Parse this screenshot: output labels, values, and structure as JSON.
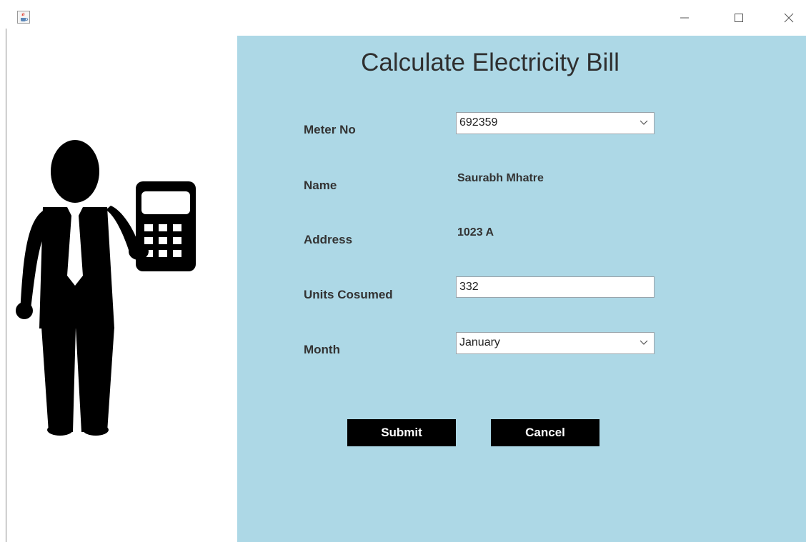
{
  "title": "Calculate Electricity Bill",
  "form": {
    "meter_label": "Meter No",
    "meter_value": "692359",
    "name_label": "Name",
    "name_value": "Saurabh Mhatre",
    "address_label": "Address",
    "address_value": "1023 A",
    "units_label": "Units Cosumed",
    "units_value": "332",
    "month_label": "Month",
    "month_value": "January"
  },
  "buttons": {
    "submit_label": "Submit",
    "cancel_label": "Cancel"
  },
  "icons": {
    "app": "java-coffee-icon",
    "minimize": "minimize-icon",
    "maximize": "maximize-icon",
    "close": "close-icon",
    "dropdown": "chevron-down-icon",
    "illustration": "businessman-calculator-icon"
  },
  "colors": {
    "panel_background": "#add8e6",
    "button_background": "#000000",
    "button_text": "#ffffff"
  }
}
